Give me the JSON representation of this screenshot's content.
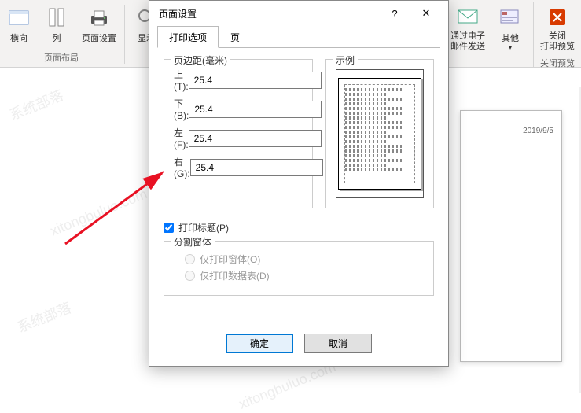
{
  "ribbon": {
    "group_layout_label": "页面布局",
    "landscape": "横向",
    "columns": "列",
    "page_setup": "页面设置",
    "show": "显示",
    "email_send": "通过电子\n邮件发送",
    "other": "其他",
    "close_preview": "关闭\n打印预览",
    "close_preview_group": "关闭预览"
  },
  "dialog": {
    "title": "页面设置",
    "tab_print": "打印选项",
    "tab_page": "页",
    "margins_legend": "页边距(毫米)",
    "example_legend": "示例",
    "top_label": "上(T):",
    "bottom_label": "下(B):",
    "left_label": "左(F):",
    "right_label": "右(G):",
    "top_val": "25.4",
    "bottom_val": "25.4",
    "left_val": "25.4",
    "right_val": "25.4",
    "print_title": "打印标题(P)",
    "split_form": "分割窗体",
    "only_form": "仅打印窗体(O)",
    "only_datasheet": "仅打印数据表(D)",
    "ok": "确定",
    "cancel": "取消"
  },
  "doc": {
    "date": "2019/9/5"
  },
  "watermarks": [
    "系统部落",
    "xitongbuluo.com",
    "系统部落",
    "xitongbuluo.com",
    "系统部落",
    "xitongbuluo.com"
  ]
}
